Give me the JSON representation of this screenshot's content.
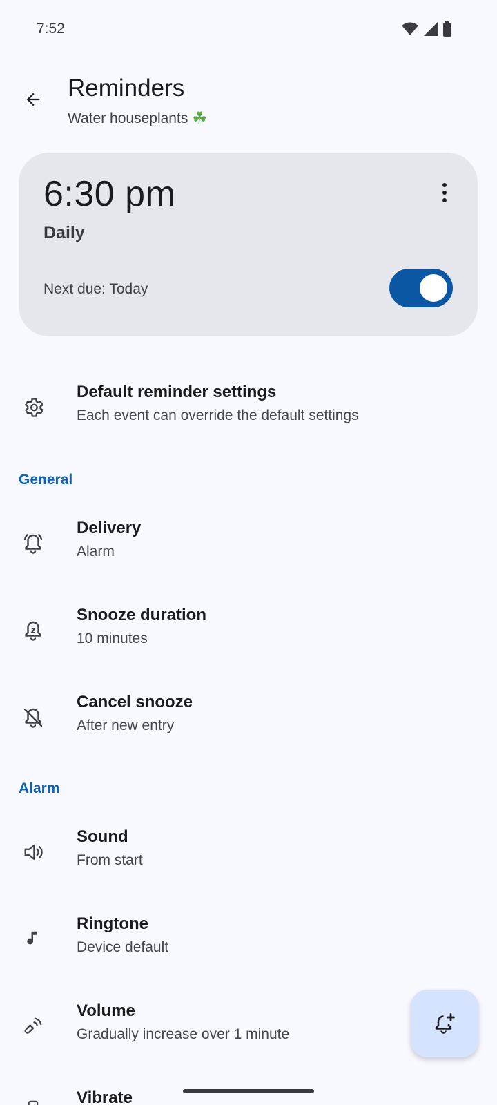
{
  "status_bar": {
    "time": "7:52"
  },
  "app_bar": {
    "title": "Reminders",
    "subtitle": "Water houseplants",
    "subtitle_emoji": "☘"
  },
  "reminder_card": {
    "time": "6:30 pm",
    "frequency": "Daily",
    "next_due": "Next due: Today",
    "enabled": true
  },
  "default_settings": {
    "title": "Default reminder settings",
    "subtitle": "Each event can override the default settings"
  },
  "sections": {
    "general": "General",
    "alarm": "Alarm"
  },
  "general_items": [
    {
      "title": "Delivery",
      "subtitle": "Alarm"
    },
    {
      "title": "Snooze duration",
      "subtitle": "10 minutes"
    },
    {
      "title": "Cancel snooze",
      "subtitle": "After new entry"
    }
  ],
  "alarm_items": [
    {
      "title": "Sound",
      "subtitle": "From start"
    },
    {
      "title": "Ringtone",
      "subtitle": "Device default"
    },
    {
      "title": "Volume",
      "subtitle": "Gradually increase over 1 minute"
    },
    {
      "title": "Vibrate",
      "subtitle": ""
    }
  ],
  "colors": {
    "accent": "#0b57a4",
    "section_header": "#0b63b8",
    "card_bg": "#e6e7ec",
    "fab_bg": "#d6e3ff",
    "background": "#f8f9ff"
  }
}
